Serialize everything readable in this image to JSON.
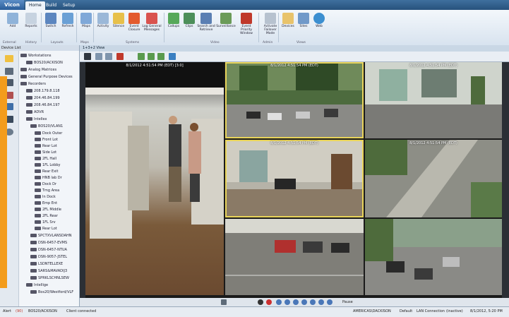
{
  "app": {
    "logo": "Vicon"
  },
  "tabs": [
    {
      "label": "Home"
    },
    {
      "label": "Build"
    },
    {
      "label": "Setup"
    }
  ],
  "ribbon": {
    "buttons": [
      {
        "label": "Add"
      },
      {
        "label": "Reports"
      },
      {
        "label": "Switch"
      },
      {
        "label": "Refresh"
      },
      {
        "label": "Maps"
      },
      {
        "label": "Activity"
      },
      {
        "label": "Silence"
      },
      {
        "label": "Event Closure"
      },
      {
        "label": "Log General Messages"
      },
      {
        "label": "Callups"
      },
      {
        "label": "Clips"
      },
      {
        "label": "Search and Retrieve"
      },
      {
        "label": "Surveillance"
      },
      {
        "label": "Event Priority Window"
      },
      {
        "label": "Activate Failover Mode"
      },
      {
        "label": "Devices"
      },
      {
        "label": "Sites"
      },
      {
        "label": "Web"
      }
    ],
    "groups": [
      {
        "label": "External"
      },
      {
        "label": "History"
      },
      {
        "label": "Layouts"
      },
      {
        "label": "Maps"
      },
      {
        "label": "Systems"
      },
      {
        "label": "Video"
      },
      {
        "label": "Admin"
      },
      {
        "label": "Views"
      }
    ]
  },
  "left": {
    "header": "Device List",
    "tree": [
      {
        "label": "Workstations"
      },
      {
        "label": "BOS20/ACKISON"
      },
      {
        "label": "Analog Matrices"
      },
      {
        "label": "General Purpose Devices"
      },
      {
        "label": "Recorders"
      },
      {
        "label": "208.179.8.118"
      },
      {
        "label": "204.46.84.199"
      },
      {
        "label": "208.46.84.197"
      },
      {
        "label": "ADVR"
      },
      {
        "label": "Intellex"
      },
      {
        "label": "BOS20/VLAN1"
      },
      {
        "label": "Dock Outer"
      },
      {
        "label": "Front Lot"
      },
      {
        "label": "Rear Lot"
      },
      {
        "label": "Side Lot"
      },
      {
        "label": "2FL Hall"
      },
      {
        "label": "1FL Lobby"
      },
      {
        "label": "Rear Exit"
      },
      {
        "label": "HNB lab Dr"
      },
      {
        "label": "Dock Dr"
      },
      {
        "label": "Tmg Area"
      },
      {
        "label": "In Dock"
      },
      {
        "label": "Emp Ent"
      },
      {
        "label": "2FL Middle"
      },
      {
        "label": "2FL Rear"
      },
      {
        "label": "1FL Srv"
      },
      {
        "label": "Rear Lot"
      },
      {
        "label": "SPCTXVLANSDAHN"
      },
      {
        "label": "DSN-6457-EVMS"
      },
      {
        "label": "DSN-6457-NTUA"
      },
      {
        "label": "DSN-9057-JSTEL"
      },
      {
        "label": "LSDNTELLEXE"
      },
      {
        "label": "SARS&MAVADIJ3"
      },
      {
        "label": "SPRKLSCHNLSEW"
      },
      {
        "label": "Intellige"
      },
      {
        "label": "Bos20/Westford/VLF"
      }
    ]
  },
  "view": {
    "tab_label": "1+3+2 View"
  },
  "cameras": [
    {
      "stamp": "8/1/2012 4:51:54 PM (EDT)\n[3:0]"
    },
    {
      "stamp": "8/1/2012 4:51:54 PM (EDT)"
    },
    {
      "stamp": "8/1/2012 4:51:54 PM (EDT)"
    },
    {
      "stamp": "8/1/2012 4:51:54 PM (EDT)"
    },
    {
      "stamp": "8/1/2012 4:51:54 PM (EDT)"
    },
    {
      "stamp": ""
    },
    {
      "stamp": ""
    },
    {
      "stamp": ""
    }
  ],
  "playback": {
    "pause_label": "Pause"
  },
  "status": {
    "alert": "Alert",
    "alert_count": "(90)",
    "user": "BOS20/ACKISON",
    "client": "Client connected",
    "server": "AMERICAS\\DACKISON",
    "mode": "Default",
    "connection": "LAN Connection",
    "state": "(inactive)",
    "datetime": "8/1/2012, 5:20 PM"
  },
  "colors": {
    "selection": "#e9d45a",
    "accent": "#f39c1c"
  }
}
